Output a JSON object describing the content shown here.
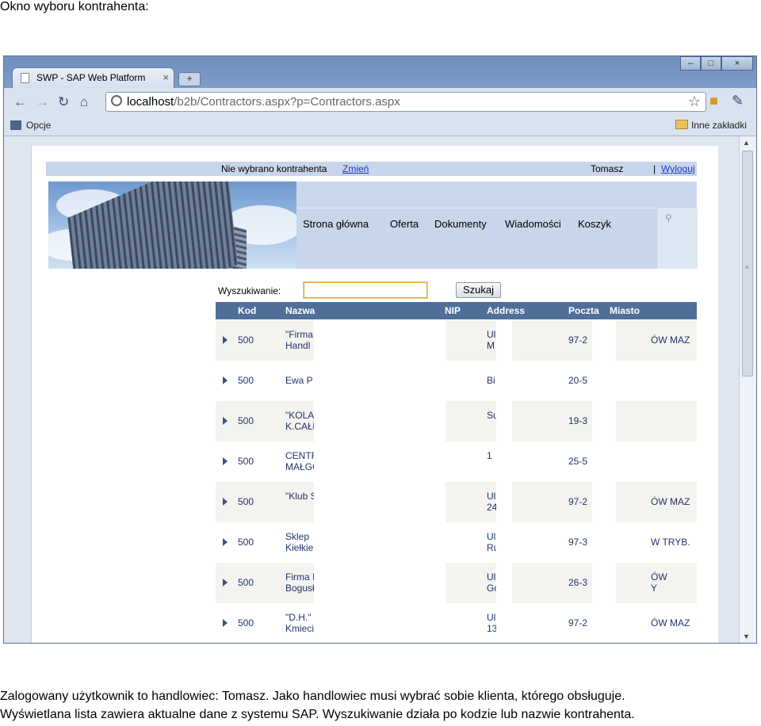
{
  "document": {
    "title": "Okno wyboru kontrahenta:",
    "caption_line1": "Zalogowany użytkownik to handlowiec: Tomasz. Jako handlowiec musi wybrać sobie klienta, którego obsługuje.",
    "caption_line2": "Wyświetlana lista zawiera aktualne dane z systemu SAP. Wyszukiwanie działa po kodzie lub nazwie kontrahenta."
  },
  "browser": {
    "tab_title": "SWP - SAP Web Platform",
    "tab_close": "×",
    "new_tab": "+",
    "url_host": "localhost",
    "url_path": "/b2b/Contractors.aspx?p=Contractors.aspx",
    "bookmarks_left": "Opcje",
    "bookmarks_right": "Inne zakładki",
    "icons": [
      "back-icon",
      "forward-icon",
      "reload-icon",
      "home-icon",
      "star-icon",
      "extension-icon",
      "wrench-icon"
    ],
    "window_buttons": [
      "minimize",
      "maximize",
      "close"
    ]
  },
  "page": {
    "status_text": "Nie wybrano kontrahenta",
    "change_link": "Zmień",
    "user_name": "Tomasz",
    "separator": "|",
    "logout_link": "Wyloguj",
    "menu": [
      "Strona główna",
      "Oferta",
      "Dokumenty",
      "Wiadomości",
      "Koszyk"
    ],
    "search_label": "Wyszukiwanie:",
    "search_value": "",
    "search_button": "Szukaj",
    "columns": [
      "Kod",
      "Nazwa",
      "NIP",
      "Address",
      "Poczta",
      "Miasto"
    ],
    "rows": [
      {
        "code": "500",
        "name1": "\"Firma",
        "name2": "Handl",
        "addr1": "Ul",
        "addr2": "M",
        "post": "97-2",
        "city1": "ÓW MAZ",
        "city2": ""
      },
      {
        "code": "500",
        "name1": "Ewa P",
        "name2": "",
        "addr1": "Bi",
        "addr2": "",
        "post": "20-5",
        "city1": "",
        "city2": ""
      },
      {
        "code": "500",
        "name1": "\"KOLA",
        "name2": "K.CAŁł",
        "addr1": "Su",
        "addr2": "",
        "post": "19-3",
        "city1": "",
        "city2": ""
      },
      {
        "code": "500",
        "name1": "CENTF",
        "name2": "MAŁGC",
        "addr1": "1",
        "addr2": "",
        "post": "25-5",
        "city1": "",
        "city2": ""
      },
      {
        "code": "500",
        "name1": "\"Klub S",
        "name2": "",
        "addr1": "Ul",
        "addr2": "24",
        "post": "97-2",
        "city1": "ÓW MAZ",
        "city2": ""
      },
      {
        "code": "500",
        "name1": "Sklep ",
        "name2": "Kiełkie",
        "addr1": "Ul",
        "addr2": "Ru",
        "post": "97-3",
        "city1": "W TRYB.",
        "city2": ""
      },
      {
        "code": "500",
        "name1": "Firma I",
        "name2": "Bogusł",
        "addr1": "Ul",
        "addr2": "Gc",
        "post": "26-3",
        "city1": "ÓW",
        "city2": "Y"
      },
      {
        "code": "500",
        "name1": "\"D.H.\"",
        "name2": "Kmieci",
        "addr1": "Ul",
        "addr2": "13",
        "post": "97-2",
        "city1": "ÓW MAZ",
        "city2": ""
      }
    ]
  }
}
